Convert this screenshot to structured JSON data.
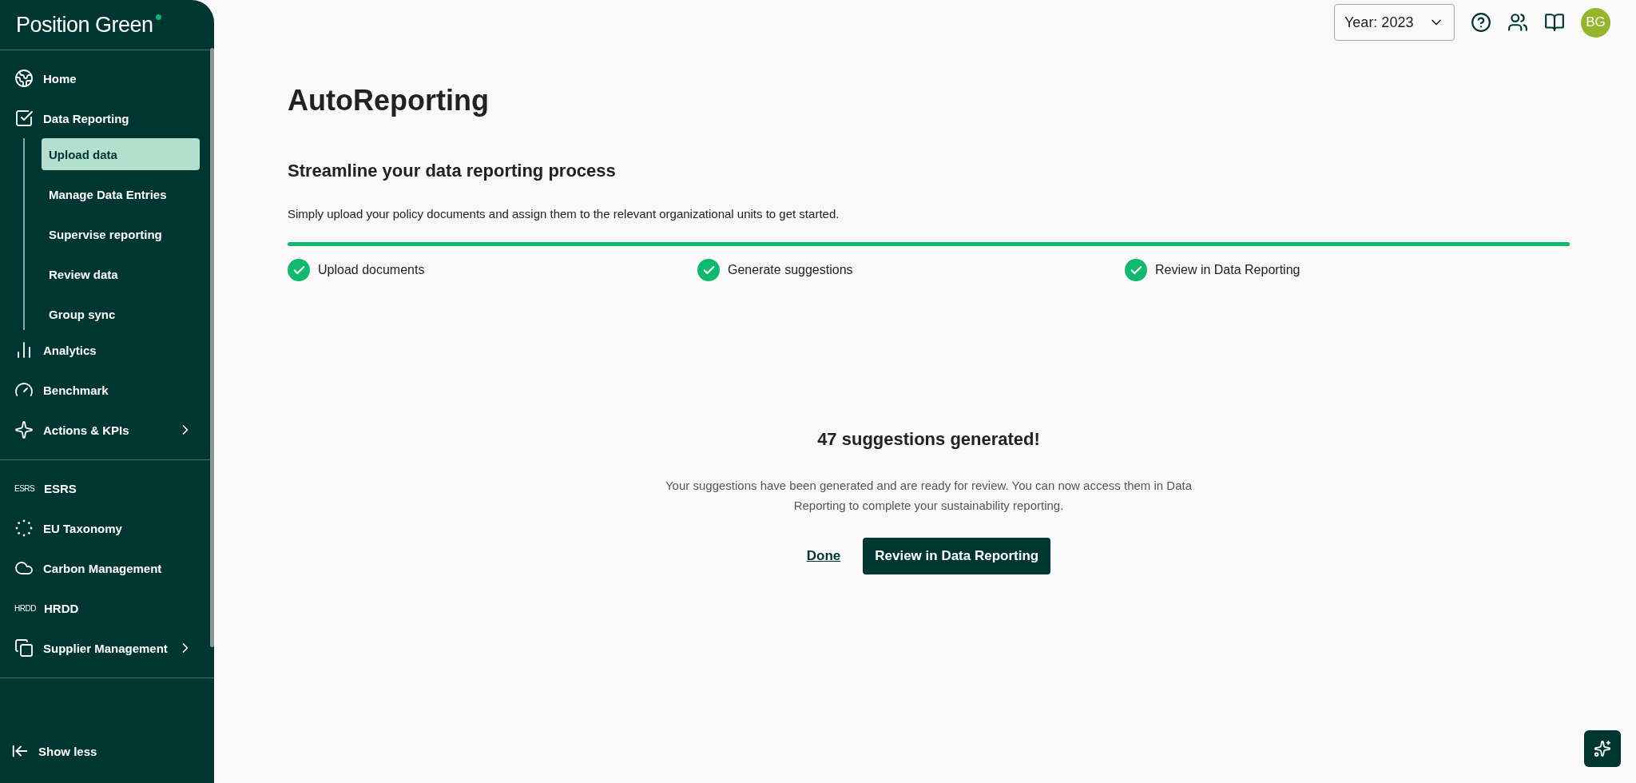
{
  "sidebar": {
    "logo": "Position Green",
    "groups": [
      [
        {
          "kind": "icon",
          "label": "Home",
          "selected": false
        },
        {
          "kind": "icon",
          "label": "Data Reporting",
          "selected": false,
          "expanded": true,
          "children": [
            {
              "label": "Upload data",
              "selected": true
            },
            {
              "label": "Manage Data Entries",
              "selected": false
            },
            {
              "label": "Supervise reporting",
              "selected": false
            },
            {
              "label": "Review data",
              "selected": false
            },
            {
              "label": "Group sync",
              "selected": false
            }
          ]
        },
        {
          "kind": "icon",
          "label": "Analytics",
          "selected": false
        },
        {
          "kind": "icon",
          "label": "Benchmark",
          "selected": false
        },
        {
          "kind": "icon",
          "label": "Actions & KPIs",
          "selected": false,
          "has_submenu": true
        }
      ],
      [
        {
          "kind": "text",
          "badge": "ESRS",
          "label": "ESRS",
          "selected": false
        },
        {
          "kind": "icon",
          "label": "EU Taxonomy",
          "selected": false
        },
        {
          "kind": "icon",
          "label": "Carbon Management",
          "selected": false
        },
        {
          "kind": "text",
          "badge": "HRDD",
          "label": "HRDD",
          "selected": false
        },
        {
          "kind": "icon",
          "label": "Supplier Management",
          "selected": false,
          "has_submenu": true
        }
      ]
    ],
    "footer": "Show less"
  },
  "topbar": {
    "year_select": "Year: 2023",
    "avatar": "BG"
  },
  "main": {
    "title": "AutoReporting",
    "subtitle": "Streamline your data reporting process",
    "description": "Simply upload your policy documents and assign them to the relevant organizational units to get started.",
    "progress": {
      "level": 1
    },
    "steps": [
      {
        "label": "Upload documents",
        "done": true
      },
      {
        "label": "Generate suggestions",
        "done": true
      },
      {
        "label": "Review in Data Reporting",
        "done": true
      }
    ],
    "result": {
      "heading": "47 suggestions generated!",
      "text": "Your suggestions have been generated and are ready for review. You can now access them in Data Reporting to complete your sustainability reporting.",
      "secondary_button": "Done",
      "primary_button": "Review in Data Reporting"
    }
  }
}
